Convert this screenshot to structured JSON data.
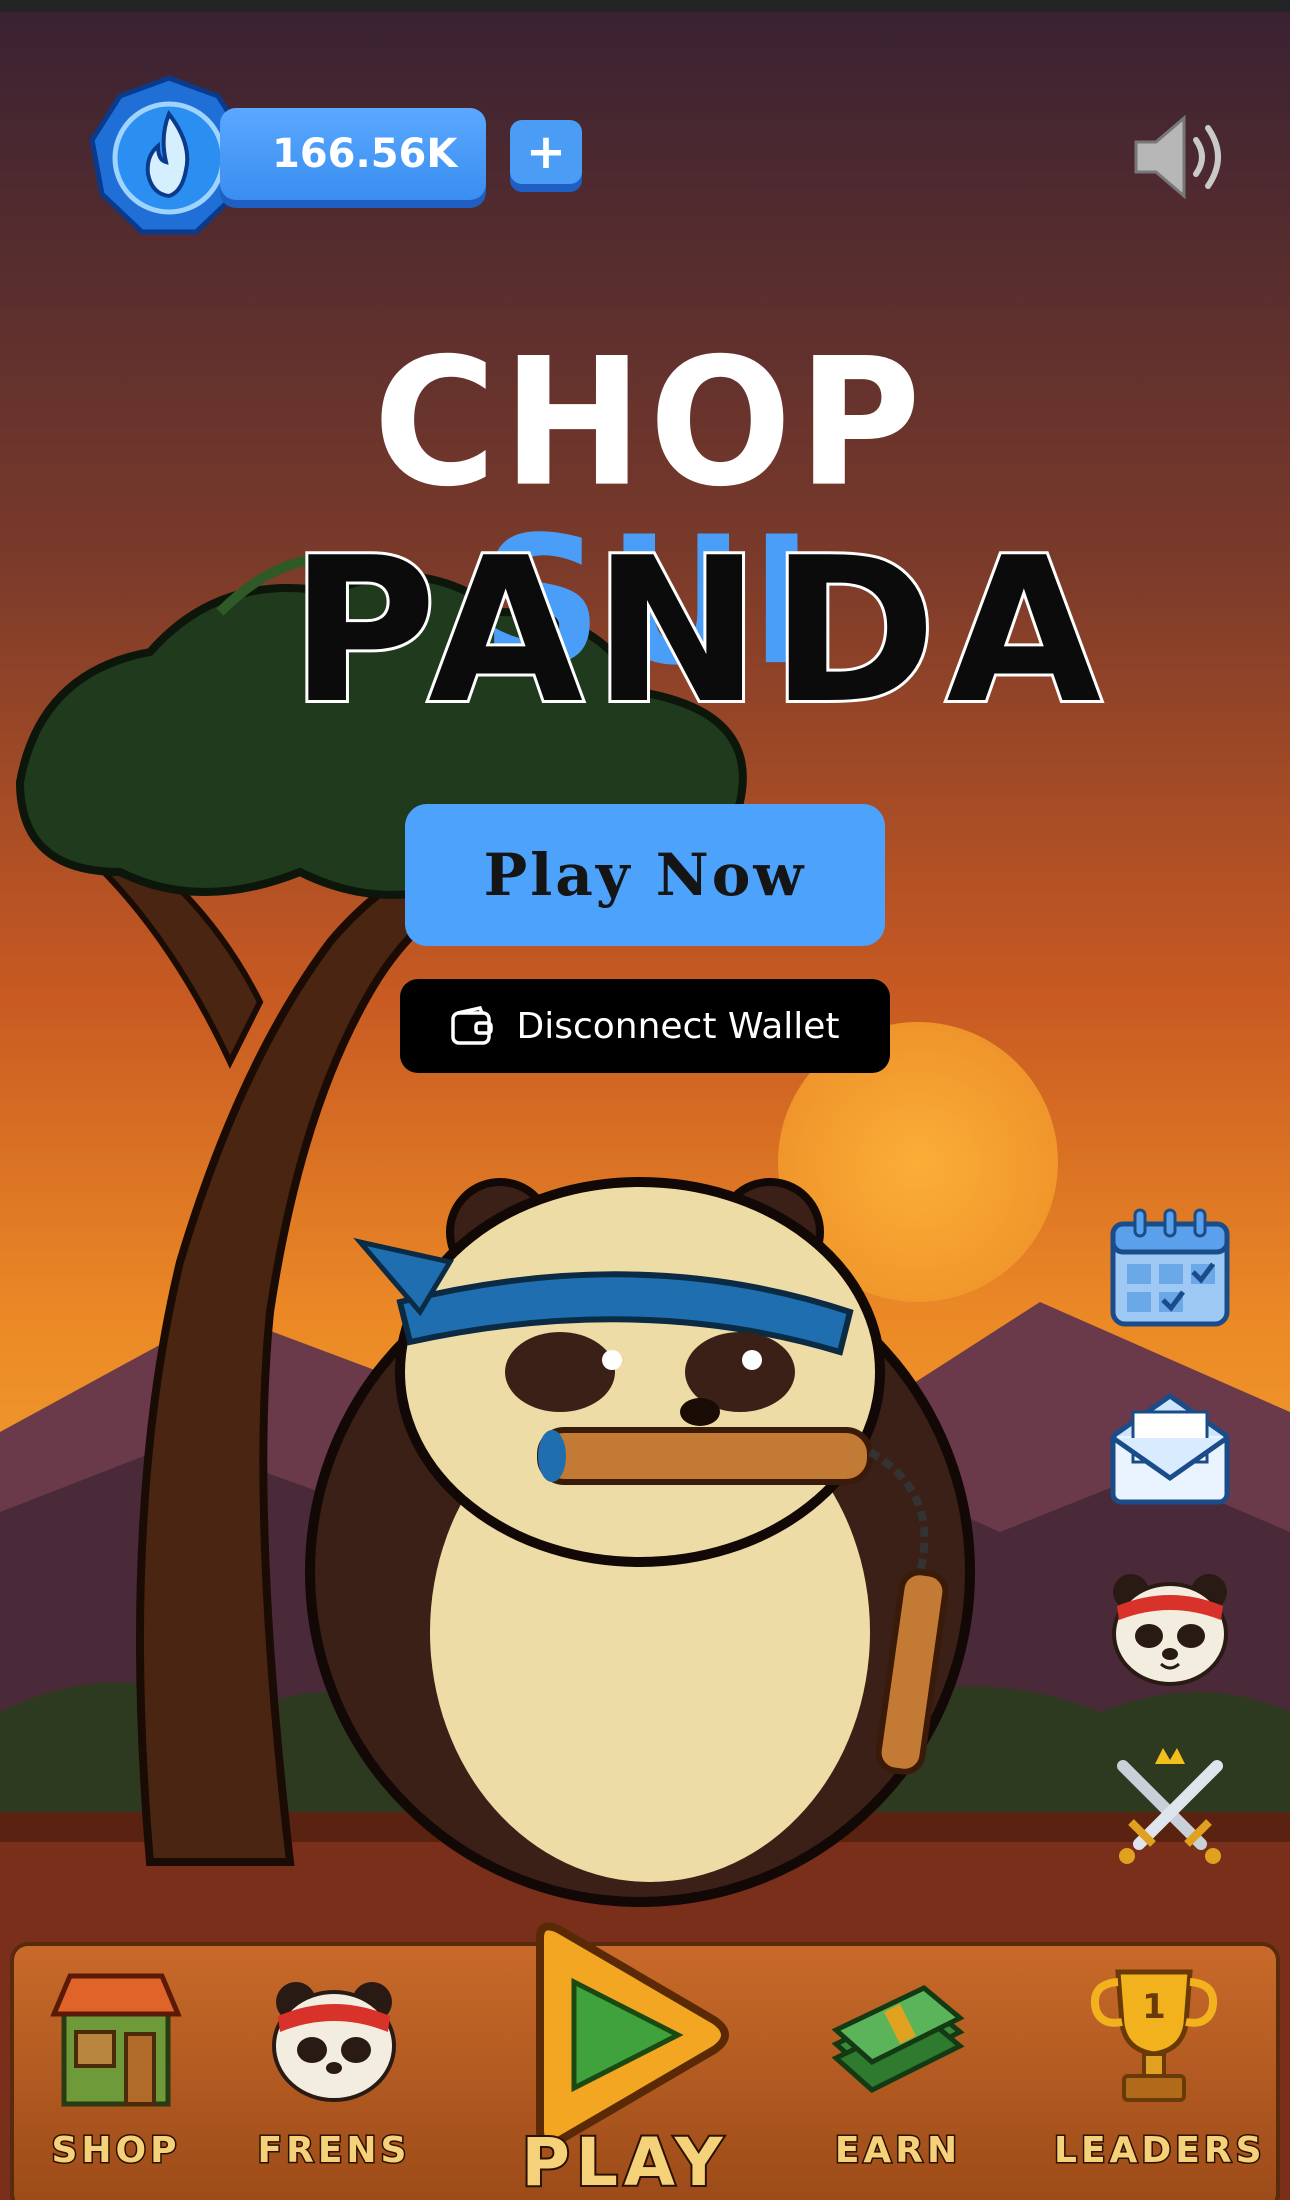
{
  "currency": {
    "balance": "166.56K",
    "add_label": "+",
    "gem_icon": "fire-gem-icon"
  },
  "sound": {
    "icon": "speaker-icon"
  },
  "title": {
    "word1": "CHOP",
    "word2": "SUI",
    "word3": "PANDA"
  },
  "buttons": {
    "play_now": "Play Now",
    "disconnect_wallet": "Disconnect Wallet"
  },
  "side_menu": [
    {
      "icon": "calendar-icon"
    },
    {
      "icon": "envelope-icon"
    },
    {
      "icon": "panda-face-icon"
    },
    {
      "icon": "crossed-swords-icon"
    }
  ],
  "nav": {
    "items": [
      {
        "label": "SHOP",
        "icon": "shop-house-icon"
      },
      {
        "label": "FRENS",
        "icon": "panda-face-icon"
      },
      {
        "label": "PLAY",
        "icon": "play-triangle-icon"
      },
      {
        "label": "EARN",
        "icon": "money-stack-icon"
      },
      {
        "label": "LEADERS",
        "icon": "trophy-icon"
      }
    ]
  },
  "colors": {
    "accent_blue": "#4da3fb",
    "title_sui": "#4b9ef7",
    "nav_label": "#f5d27a",
    "sky_top": "#3a2232",
    "sky_bottom": "#f0a030"
  }
}
